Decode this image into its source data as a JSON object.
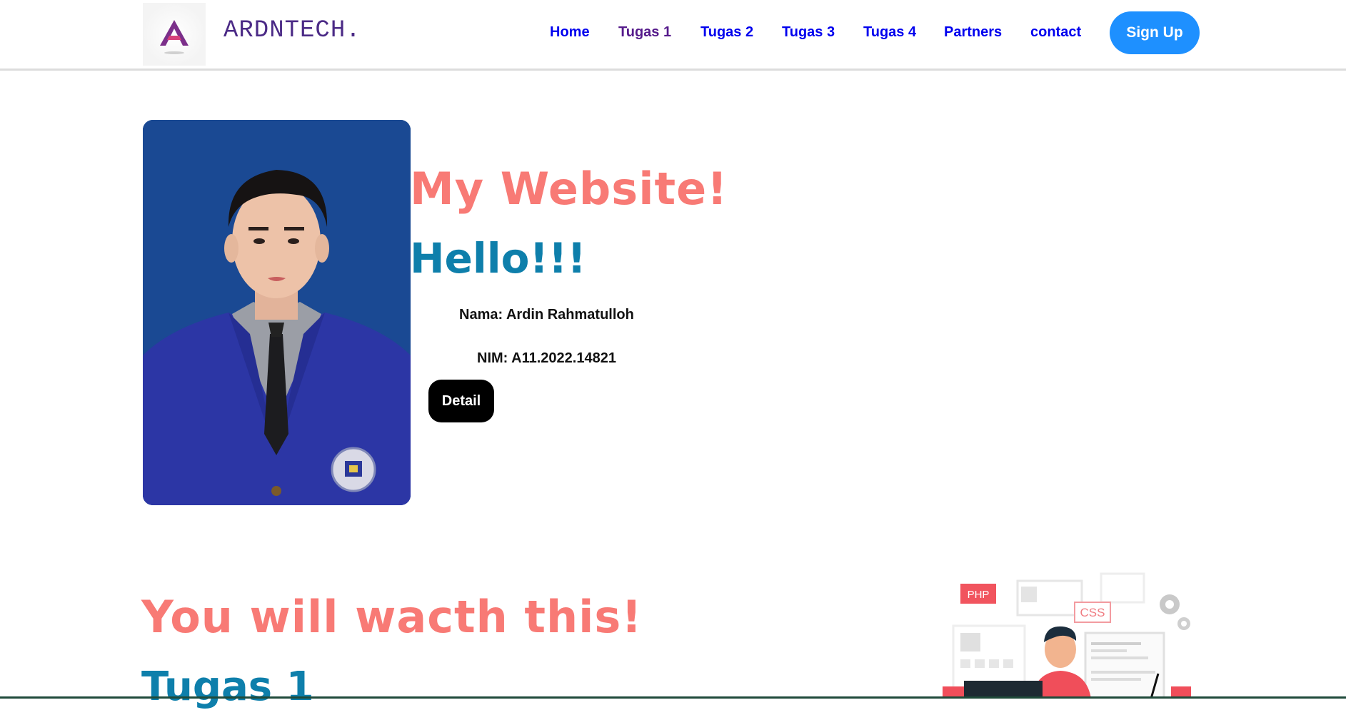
{
  "brand": {
    "name": "ARDNTECH."
  },
  "nav": {
    "items": [
      {
        "label": "Home",
        "color": "#0000ee"
      },
      {
        "label": "Tugas 1",
        "color": "#551a8b"
      },
      {
        "label": "Tugas 2",
        "color": "#0000ee"
      },
      {
        "label": "Tugas 3",
        "color": "#0000ee"
      },
      {
        "label": "Tugas 4",
        "color": "#0000ee"
      },
      {
        "label": "Partners",
        "color": "#0000ee"
      },
      {
        "label": "contact",
        "color": "#0000ee"
      }
    ],
    "signup_label": "Sign Up",
    "signup_color": "#1e90ff"
  },
  "hero": {
    "title": "My Website!",
    "greeting": "Hello!!!",
    "nama": "Nama: Ardin Rahmatulloh",
    "nim": "NIM: A11.2022.14821",
    "detail_label": "Detail"
  },
  "section": {
    "title": "You will wacth this!",
    "subtitle": "Tugas 1",
    "illustration_tags": [
      "PHP",
      "CSS"
    ]
  },
  "colors": {
    "accent_pink": "#f87a75",
    "accent_teal": "#0e7fab",
    "photo_bg": "#1a4993"
  }
}
